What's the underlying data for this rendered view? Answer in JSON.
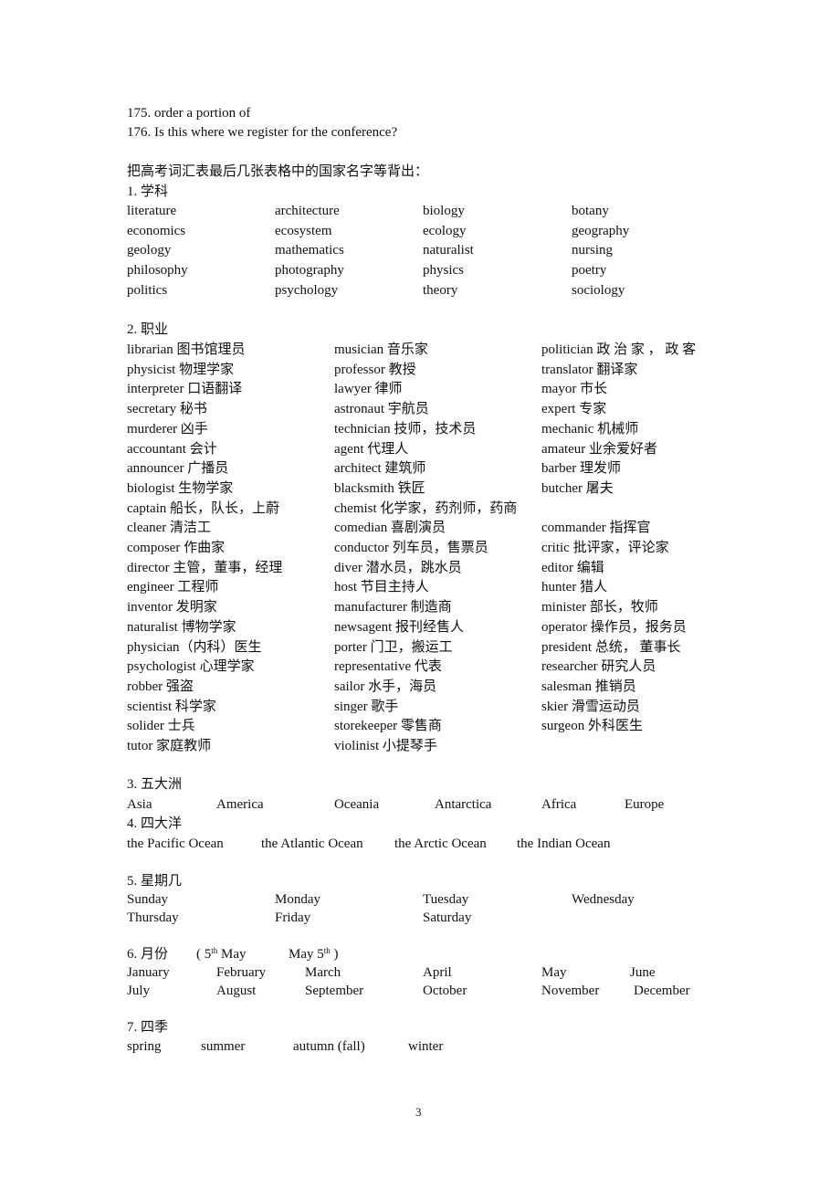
{
  "intro": {
    "line_175": "175. order a portion of",
    "line_176": "176. Is this where we register for the conference?",
    "instruction": "把高考词汇表最后几张表格中的国家名字等背出："
  },
  "sections": {
    "subjects": {
      "heading": "1. 学科",
      "rows": [
        [
          "literature",
          "architecture",
          "biology",
          "botany"
        ],
        [
          "economics",
          "ecosystem",
          "ecology",
          "geography"
        ],
        [
          "geology",
          "mathematics",
          "naturalist",
          "nursing"
        ],
        [
          "philosophy",
          "photography",
          "physics",
          "poetry"
        ],
        [
          "politics",
          "psychology",
          "theory",
          "sociology"
        ]
      ]
    },
    "occupations": {
      "heading": "2. 职业",
      "col1": [
        "librarian 图书馆理员",
        "physicist  物理学家",
        "interpreter  口语翻译",
        "secretary 秘书",
        "murderer  凶手",
        "accountant 会计",
        "announcer 广播员",
        "biologist 生物学家",
        "captain 船长，队长，上蔚",
        "cleaner 清洁工",
        "composer 作曲家",
        "director 主管，董事，经理",
        "engineer 工程师",
        "inventor 发明家",
        "naturalist 博物学家",
        "physician（内科）医生",
        "psychologist 心理学家",
        "robber 强盗",
        "scientist 科学家",
        "solider 士兵",
        "tutor 家庭教师"
      ],
      "col2": [
        "musician  音乐家",
        "professor  教授",
        "lawyer 律师",
        "astronaut  宇航员",
        "technician 技师，技术员",
        "agent 代理人",
        "architect 建筑师",
        "blacksmith 铁匠",
        "chemist 化学家，药剂师，药商",
        "comedian 喜剧演员",
        "conductor 列车员，售票员",
        "diver 潜水员，跳水员",
        "host 节目主持人",
        "manufacturer 制造商",
        "newsagent 报刊经售人",
        "porter 门卫，搬运工",
        "representative 代表",
        "sailor 水手，海员",
        "singer 歌手",
        "storekeeper 零售商",
        "violinist 小提琴手"
      ],
      "col3": [
        "politician 政 治 家 ， 政 客",
        "translator 翻译家",
        "mayor 市长",
        "expert  专家",
        "mechanic 机械师",
        "amateur 业余爱好者",
        "barber 理发师",
        "butcher 屠夫",
        "",
        "commander  指挥官",
        "critic 批评家，评论家",
        "editor 编辑",
        "hunter 猎人",
        "minister 部长，牧师",
        "operator 操作员，报务员",
        "president 总统，  董事长",
        "researcher 研究人员",
        "salesman 推销员",
        "skier 滑雪运动员",
        "surgeon 外科医生"
      ]
    },
    "continents": {
      "heading": "3. 五大洲",
      "items": [
        "Asia",
        "America",
        "Oceania",
        "Antarctica",
        "Africa",
        "Europe"
      ]
    },
    "oceans": {
      "heading": "4. 四大洋",
      "items": [
        "the Pacific Ocean",
        "the Atlantic Ocean",
        "the Arctic Ocean",
        "the Indian Ocean"
      ]
    },
    "weekdays": {
      "heading": "5. 星期几",
      "rows": [
        [
          "Sunday",
          "Monday",
          "Tuesday",
          "Wednesday"
        ],
        [
          "Thursday",
          "Friday",
          "Saturday"
        ]
      ]
    },
    "months": {
      "heading": "6. 月份",
      "note_open": "( 5",
      "note_sup1": "th",
      "note_mid": " May",
      "note2_pre": "May 5",
      "note_sup2": "th",
      "note_close": " )",
      "rows": [
        [
          "January",
          "February",
          "March",
          "April",
          "May",
          "June"
        ],
        [
          "July",
          "August",
          "September",
          "October",
          "November",
          "December"
        ]
      ]
    },
    "seasons": {
      "heading": "7. 四季",
      "items": [
        "spring",
        "summer",
        "autumn (fall)",
        "winter"
      ]
    }
  },
  "footer": {
    "page_number": "3"
  }
}
